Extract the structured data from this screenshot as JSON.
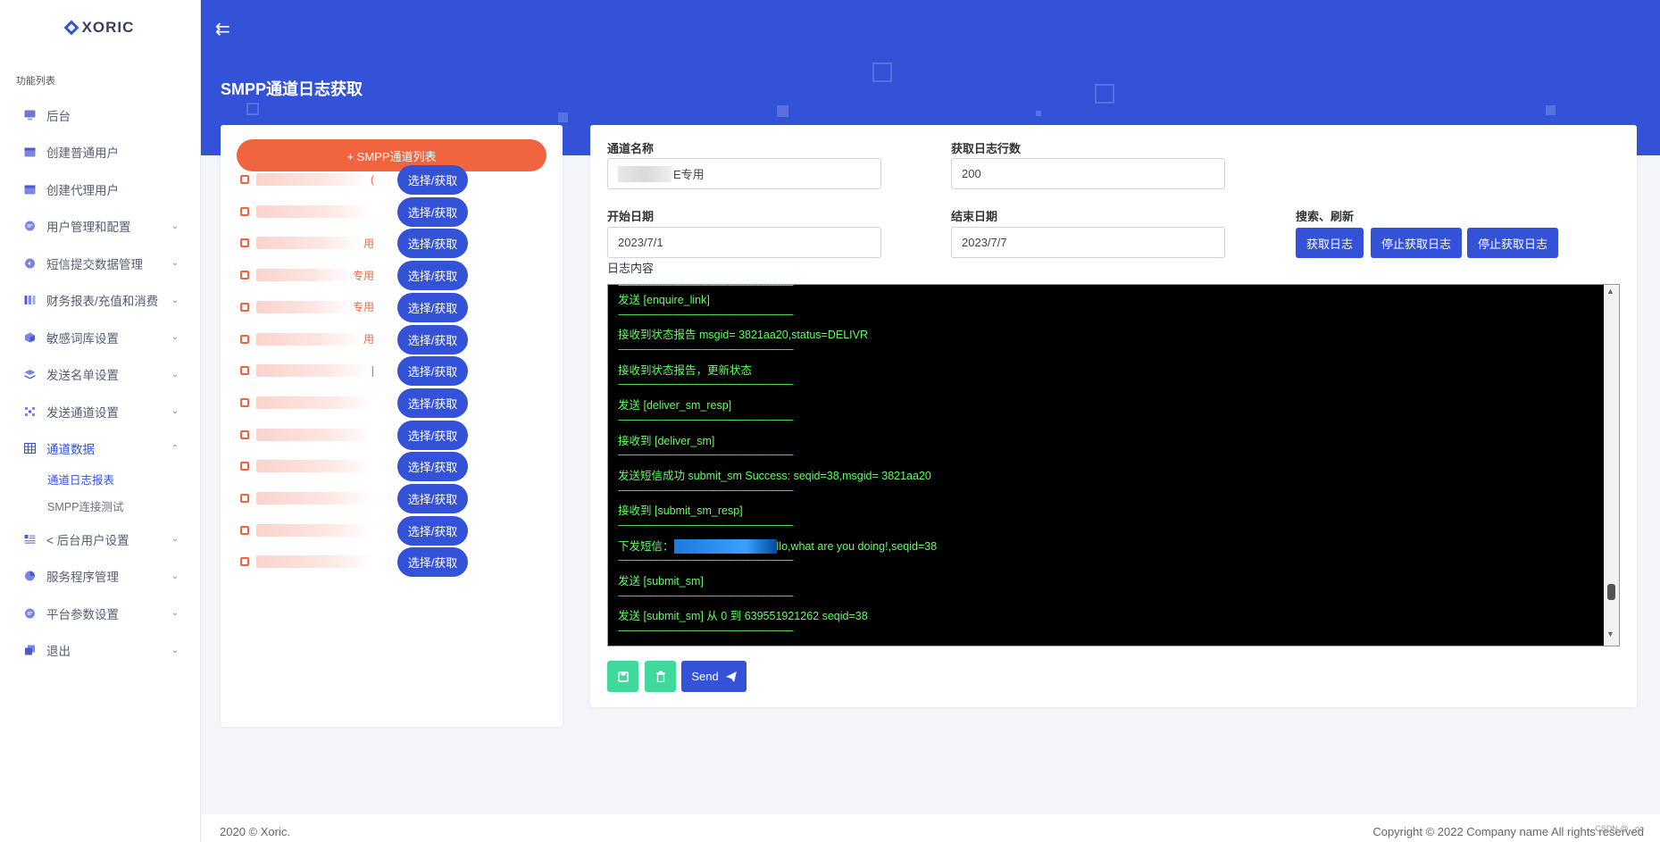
{
  "brand": "XORIC",
  "menu_caption": "功能列表",
  "menu": [
    {
      "label": "后台",
      "icon": "monitor-icon",
      "chevron": ""
    },
    {
      "label": "创建普通用户",
      "icon": "calendar-icon",
      "chevron": ""
    },
    {
      "label": "创建代理用户",
      "icon": "calendar-icon",
      "chevron": ""
    },
    {
      "label": "用户管理和配置",
      "icon": "chat-icon",
      "chevron": "⌄"
    },
    {
      "label": "短信提交数据管理",
      "icon": "message-icon",
      "chevron": "⌄"
    },
    {
      "label": "财务报表/充值和消费",
      "icon": "bars-icon",
      "chevron": "⌄"
    },
    {
      "label": "敏感词库设置",
      "icon": "cube-icon",
      "chevron": "⌄"
    },
    {
      "label": "发送名单设置",
      "icon": "layers-icon",
      "chevron": "⌄"
    },
    {
      "label": "发送通道设置",
      "icon": "target-icon",
      "chevron": "⌄"
    },
    {
      "label": "通道数据",
      "icon": "grid-icon",
      "chevron": "⌃"
    }
  ],
  "submenu": [
    "通道日志报表",
    "SMPP连接测试"
  ],
  "menu_after": [
    {
      "label": "< 后台用户设置",
      "icon": "list-icon",
      "chevron": "⌄"
    },
    {
      "label": "服务程序管理",
      "icon": "pie-icon",
      "chevron": "⌄"
    },
    {
      "label": "平台参数设置",
      "icon": "chat-icon",
      "chevron": "⌄"
    },
    {
      "label": "退出",
      "icon": "copy-icon",
      "chevron": "⌄"
    }
  ],
  "page_title": "SMPP通道日志获取",
  "channel_list_button": "+ SMPP通道列表",
  "channels": [
    {
      "suffix": "(",
      "button": "选择/获取"
    },
    {
      "suffix": "",
      "button": "选择/获取"
    },
    {
      "suffix": "用",
      "button": "选择/获取"
    },
    {
      "suffix": "专用",
      "button": "选择/获取"
    },
    {
      "suffix": "专用",
      "button": "选择/获取"
    },
    {
      "suffix": "用",
      "button": "选择/获取"
    },
    {
      "suffix": "]",
      "button": "选择/获取"
    },
    {
      "suffix": "",
      "button": "选择/获取"
    },
    {
      "suffix": "",
      "button": "选择/获取"
    },
    {
      "suffix": "",
      "button": "选择/获取"
    },
    {
      "suffix": "",
      "button": "选择/获取"
    },
    {
      "suffix": "",
      "button": "选择/获取"
    },
    {
      "suffix": "",
      "button": "选择/获取"
    }
  ],
  "form": {
    "channel_name_label": "通道名称",
    "channel_name_value": "E专用",
    "lines_label": "获取日志行数",
    "lines_value": "200",
    "start_label": "开始日期",
    "start_value": "2023/7/1",
    "end_label": "结束日期",
    "end_value": "2023/7/7",
    "search_label": "搜索、刷新",
    "btn_get": "获取日志",
    "btn_stop1": "停止获取日志",
    "btn_stop2": "停止获取日志",
    "log_label": "日志内容"
  },
  "log_lines": [
    "发送 [enquire_link]",
    "接收到状态报告 msgid= 3821aa20,status=DELIVR",
    "接收到状态报告，更新状态",
    "发送 [deliver_sm_resp]",
    "接收到 [deliver_sm]",
    "发送短信成功 submit_sm Success: seqid=38,msgid= 3821aa20",
    "接收到 [submit_sm_resp]",
    "llo,what are you doing!,seqid=38",
    "发送 [submit_sm]",
    "发送 [submit_sm] 从 0 到 639551921262 seqid=38"
  ],
  "sms_prefix": "下发短信：",
  "separator": "--------------------------------------------------------------",
  "send_label": "Send",
  "footer_left": "2020 © Xoric.",
  "footer_right": "Copyright © 2022 Company name All rights reserved",
  "watermark": "CSDN @ _oo"
}
